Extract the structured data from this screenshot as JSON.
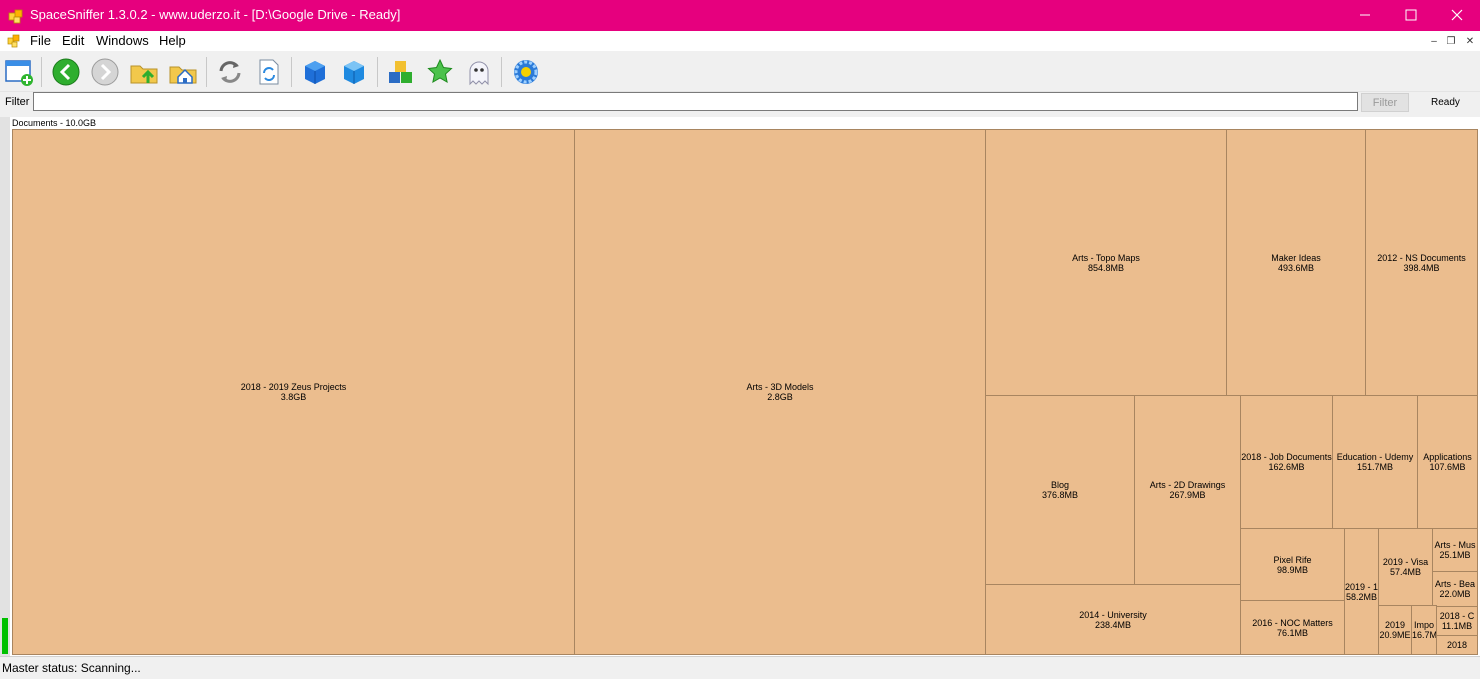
{
  "window": {
    "title": "SpaceSniffer 1.3.0.2 - www.uderzo.it - [D:\\Google Drive - Ready]",
    "title_bar_color": "#e6007e"
  },
  "menu": {
    "items": [
      "File",
      "Edit",
      "Windows",
      "Help"
    ]
  },
  "toolbar": {
    "buttons": [
      {
        "name": "new-scan-icon"
      },
      {
        "name": "back-arrow-icon"
      },
      {
        "name": "forward-arrow-icon"
      },
      {
        "name": "parent-folder-icon"
      },
      {
        "name": "home-folder-icon"
      },
      {
        "name": "refresh-icon"
      },
      {
        "name": "refresh-document-icon"
      },
      {
        "name": "zoom-in-cube-icon"
      },
      {
        "name": "zoom-out-cube-icon"
      },
      {
        "name": "colored-cubes-icon"
      },
      {
        "name": "star-icon"
      },
      {
        "name": "ghost-icon"
      },
      {
        "name": "settings-flower-icon"
      }
    ]
  },
  "filter": {
    "label": "Filter",
    "value": "",
    "button_label": "Filter",
    "status": "Ready"
  },
  "treemap": {
    "root_label": "Documents - 10.0GB",
    "tile_color": "#ebbd8e",
    "tiles": [
      {
        "name": "2018 - 2019 Zeus Projects",
        "size": "3.8GB"
      },
      {
        "name": "Arts - 3D Models",
        "size": "2.8GB"
      },
      {
        "name": "Arts - Topo Maps",
        "size": "854.8MB"
      },
      {
        "name": "Maker Ideas",
        "size": "493.6MB"
      },
      {
        "name": "2012 - NS Documents",
        "size": "398.4MB"
      },
      {
        "name": "Blog",
        "size": "376.8MB"
      },
      {
        "name": "Arts - 2D Drawings",
        "size": "267.9MB"
      },
      {
        "name": "2018 - Job Documents",
        "size": "162.6MB"
      },
      {
        "name": "Education - Udemy",
        "size": "151.7MB"
      },
      {
        "name": "Applications",
        "size": "107.6MB"
      },
      {
        "name": "2014 - University",
        "size": "238.4MB"
      },
      {
        "name": "Pixel Rife",
        "size": "98.9MB"
      },
      {
        "name": "2016 - NOC Matters",
        "size": "76.1MB"
      },
      {
        "name": "2019 - 1",
        "size": "58.2MB"
      },
      {
        "name": "2019 - Visa",
        "size": "57.4MB"
      },
      {
        "name": "Arts - Mus",
        "size": "25.1MB"
      },
      {
        "name": "Arts - Bea",
        "size": "22.0MB"
      },
      {
        "name": "2019",
        "size": "20.9ME"
      },
      {
        "name": "Impo",
        "size": "16.7M"
      },
      {
        "name": "2018 - C",
        "size": "11.1MB"
      },
      {
        "name": "2018",
        "size": ""
      }
    ]
  },
  "status": {
    "text": "Master status: Scanning...",
    "scan_progress_color": "#00c000"
  }
}
